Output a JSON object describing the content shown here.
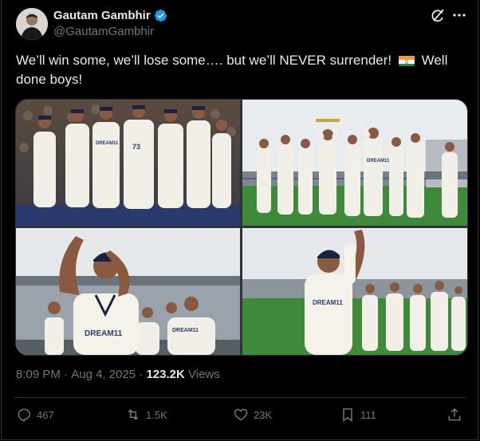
{
  "author": {
    "name": "Gautam Gambhir",
    "handle": "@GautamGambhir",
    "verified": true
  },
  "tweet": {
    "text_before_flag": "We’ll win some, we’ll lose some…. but we’ll NEVER surrender!",
    "flag_icon": "india-flag-icon",
    "text_after_flag": "Well done boys!"
  },
  "media": {
    "images": [
      {
        "jersey_text": "DREAM11",
        "numbers": "73"
      },
      {
        "jersey_text": "DREAM11"
      },
      {
        "jersey_text": "DREAM11"
      },
      {
        "jersey_text": "DREAM11"
      }
    ]
  },
  "meta": {
    "time": "8:09 PM",
    "separator": " · ",
    "date": "Aug 4, 2025",
    "views_count": "123.2K",
    "views_label": " Views"
  },
  "actions": {
    "replies": "467",
    "reposts": "1.5K",
    "likes": "23K",
    "bookmarks": "111"
  },
  "colors": {
    "background": "#000000",
    "text": "#e7e9ea",
    "muted": "#71767b",
    "verified": "#1d9bf0",
    "border": "#2f3336"
  }
}
